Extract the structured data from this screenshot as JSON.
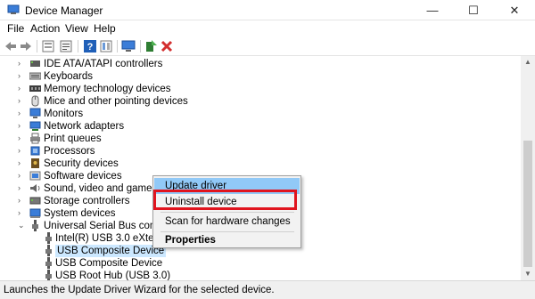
{
  "window": {
    "title": "Device Manager",
    "buttons": {
      "minimize": "—",
      "maximize": "☐",
      "close": "✕"
    }
  },
  "menubar": {
    "items": [
      "File",
      "Action",
      "View",
      "Help"
    ]
  },
  "toolbar": {
    "icons": [
      "back-arrow-icon",
      "forward-arrow-icon",
      "device-tree-icon",
      "properties-icon",
      "help-icon",
      "details-icon",
      "monitor-scan-icon",
      "enable-driver-icon",
      "uninstall-x-icon"
    ]
  },
  "tree": {
    "categories": [
      {
        "label": "IDE ATA/ATAPI controllers",
        "icon": "ide-controller-icon"
      },
      {
        "label": "Keyboards",
        "icon": "keyboard-icon"
      },
      {
        "label": "Memory technology devices",
        "icon": "memory-device-icon"
      },
      {
        "label": "Mice and other pointing devices",
        "icon": "mouse-icon"
      },
      {
        "label": "Monitors",
        "icon": "monitor-icon"
      },
      {
        "label": "Network adapters",
        "icon": "network-adapter-icon"
      },
      {
        "label": "Print queues",
        "icon": "printer-icon"
      },
      {
        "label": "Processors",
        "icon": "processor-icon"
      },
      {
        "label": "Security devices",
        "icon": "security-device-icon"
      },
      {
        "label": "Software devices",
        "icon": "software-device-icon"
      },
      {
        "label": "Sound, video and game co",
        "icon": "speaker-icon"
      },
      {
        "label": "Storage controllers",
        "icon": "storage-controller-icon"
      },
      {
        "label": "System devices",
        "icon": "system-device-icon"
      },
      {
        "label": "Universal Serial Bus contro",
        "icon": "usb-controller-icon"
      }
    ],
    "usb_children": [
      {
        "label": "Intel(R) USB 3.0 eXtensi"
      },
      {
        "label": "USB Composite Device",
        "selected": true
      },
      {
        "label": "USB Composite Device"
      },
      {
        "label": "USB Root Hub (USB 3.0)"
      }
    ]
  },
  "context_menu": {
    "items": [
      "Update driver",
      "Uninstall device",
      "Scan for hardware changes",
      "Properties"
    ],
    "highlighted": "Update driver",
    "outlined": "Uninstall device",
    "outline_color": "#e0141e"
  },
  "status_bar": {
    "text": "Launches the Update Driver Wizard for the selected device."
  },
  "colors": {
    "selection": "#cce8ff",
    "menu_highlight": "#91c9f7"
  }
}
